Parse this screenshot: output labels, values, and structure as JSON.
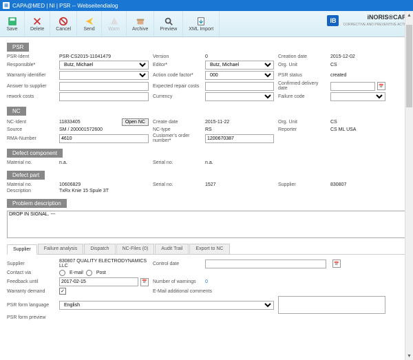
{
  "window": {
    "title": "CAPA@MED | NI | PSR -- Webseitendialog"
  },
  "toolbar": {
    "save": "Save",
    "delete": "Delete",
    "cancel": "Cancel",
    "send": "Send",
    "warn": "Warn",
    "archive": "Archive",
    "preview": "Preview",
    "xmlimport": "XML Import"
  },
  "brand": {
    "ib": "IB",
    "name": "iNORIS®CAPA",
    "sub": "CORRECTIVE AND PREVENTIVE ACTION"
  },
  "psr": {
    "heading": "PSR",
    "ident_label": "PSR-Ident",
    "ident": "PSR-CS2015-11041479",
    "responsible_label": "Responsible",
    "responsible": "Butz, Michael",
    "warranty_label": "Warranty identifier",
    "answer_label": "Answer to supplier",
    "rework_label": "rework costs",
    "version_label": "Version",
    "version": "0",
    "editor_label": "Editor",
    "editor": "Butz, Michael",
    "actioncode_label": "Action code factor",
    "actioncode": "000",
    "repair_label": "Expected repair costs",
    "currency_label": "Currency",
    "creation_label": "Creation date",
    "creation": "2015-12-02",
    "orgunit_label": "Org. Unit",
    "orgunit": "CS",
    "status_label": "PSR status",
    "status": "created",
    "conf_label": "Confirmed delivery date",
    "failure_label": "Failure code"
  },
  "nc": {
    "heading": "NC",
    "ident_label": "NC-Ident",
    "ident": "11833405",
    "open_btn": "Open NC",
    "source_label": "Source",
    "source": "SM / 200001572600",
    "rma_label": "RMA-Number",
    "rma": "4610",
    "create_label": "Create date",
    "create": "2015-11-22",
    "type_label": "NC-type",
    "type": "RS",
    "custorder_label": "Customer's order number",
    "custorder": "1200670387",
    "orgunit_label": "Org. Unit",
    "orgunit": "CS",
    "reporter_label": "Reporter",
    "reporter": "CS ML USA"
  },
  "defcomp": {
    "heading": "Defect component",
    "material_label": "Material no.",
    "material": "n.a.",
    "serial_label": "Serial no.",
    "serial": "n.a."
  },
  "defpart": {
    "heading": "Defect part",
    "material_label": "Material no.",
    "material": "10606829",
    "desc_label": "Description",
    "desc": "TxRx Knie 15 Spule 3T",
    "serial_label": "Serial no.",
    "serial": "1527",
    "supplier_label": "Supplier",
    "supplier": "830807"
  },
  "problem": {
    "heading": "Problem description",
    "text": "DROP IN SIGNAL. ---"
  },
  "tabs": {
    "supplier": "Supplier",
    "failure": "Failure analysis",
    "dispatch": "Dispatch",
    "ncfiles": "NC-Files (0)",
    "audit": "Audit Trail",
    "export": "Export to NC"
  },
  "suppane": {
    "supplier_label": "Supplier",
    "supplier": "830807 QUALITY ELECTRODYNAMICS LLC",
    "contact_label": "Contact via",
    "email": "E-mail",
    "post": "Post",
    "feedback_label": "Feedback until",
    "feedback": "2017-02-15",
    "warranty_label": "Warranty demand",
    "lang_label": "PSR form language",
    "lang": "English",
    "preview_label": "PSR form preview",
    "control_label": "Control date",
    "warnings_label": "Number of warnings",
    "warnings": "0",
    "addcomm_label": "E-Mail additional comments"
  }
}
